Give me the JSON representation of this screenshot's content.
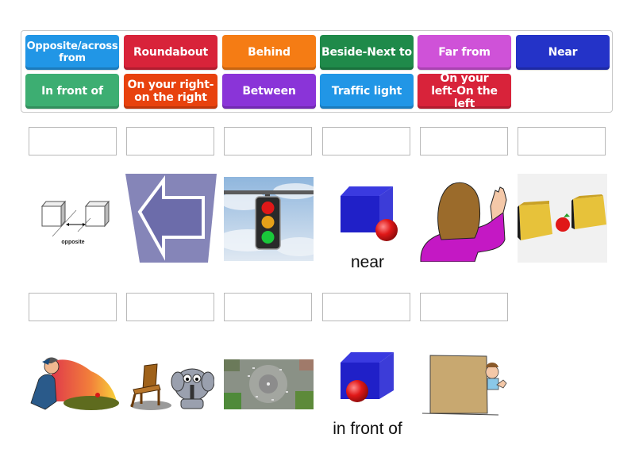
{
  "tiles": [
    {
      "label": "Opposite/across from",
      "color": "#2196e6"
    },
    {
      "label": "Roundabout",
      "color": "#d8233a"
    },
    {
      "label": "Behind",
      "color": "#f57c14"
    },
    {
      "label": "Beside-Next to",
      "color": "#1f8a4a"
    },
    {
      "label": "Far from",
      "color": "#cf52d8"
    },
    {
      "label": "Near",
      "color": "#2433c8"
    },
    {
      "label": "In front of",
      "color": "#3dae72"
    },
    {
      "label": "On your right-on the right",
      "color": "#e8420e"
    },
    {
      "label": "Between",
      "color": "#8a34d8"
    },
    {
      "label": "Traffic light",
      "color": "#2196e6"
    },
    {
      "label": "On your left-On the left",
      "color": "#d8233a"
    }
  ],
  "tile_lines": [
    [
      "Opposite/across",
      "from"
    ],
    [
      "Roundabout"
    ],
    [
      "Behind"
    ],
    [
      "Beside-Next to"
    ],
    [
      "Far from"
    ],
    [
      "Near"
    ],
    [
      "In front of"
    ],
    [
      "On your right-",
      "on the right"
    ],
    [
      "Between"
    ],
    [
      "Traffic light"
    ],
    [
      "On your",
      "left-On the left"
    ]
  ],
  "images": [
    {
      "name": "opposite-image",
      "icon": "opposite-cubes",
      "caption_in_image": "opposite"
    },
    {
      "name": "left-arrow-image",
      "icon": "left-arrow"
    },
    {
      "name": "traffic-light-image",
      "icon": "traffic-light"
    },
    {
      "name": "near-image",
      "icon": "cube-ball-near",
      "caption": "near"
    },
    {
      "name": "raised-right-hand-image",
      "icon": "girl-waving"
    },
    {
      "name": "between-image",
      "icon": "apple-between-boxes"
    },
    {
      "name": "far-from-image",
      "icon": "man-looking-far"
    },
    {
      "name": "beside-image",
      "icon": "chair-elephant"
    },
    {
      "name": "roundabout-image",
      "icon": "roundabout-aerial"
    },
    {
      "name": "in-front-of-image",
      "icon": "ball-in-front-cube",
      "caption": "in front of"
    },
    {
      "name": "behind-image",
      "icon": "boy-behind-box"
    }
  ],
  "captions": {
    "near": "near",
    "in_front_of": "in front of",
    "opposite": "opposite"
  }
}
